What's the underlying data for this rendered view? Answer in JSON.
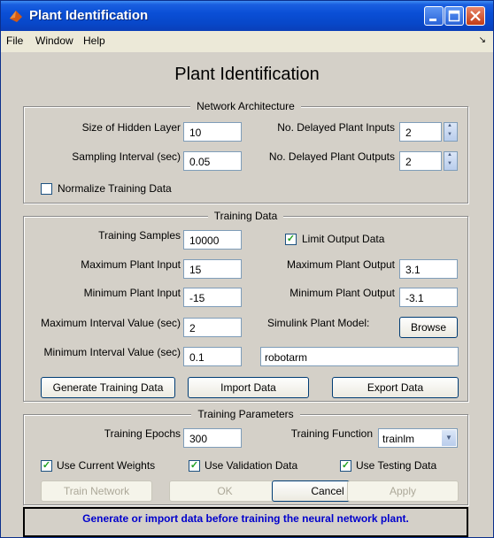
{
  "window": {
    "title": "Plant Identification"
  },
  "menu": {
    "items": [
      "File",
      "Window",
      "Help"
    ]
  },
  "heading": "Plant Identification",
  "network_architecture": {
    "title": "Network Architecture",
    "hidden_layer_label": "Size of Hidden Layer",
    "hidden_layer_value": "10",
    "sampling_interval_label": "Sampling Interval (sec)",
    "sampling_interval_value": "0.05",
    "delayed_inputs_label": "No. Delayed Plant Inputs",
    "delayed_inputs_value": "2",
    "delayed_outputs_label": "No. Delayed Plant Outputs",
    "delayed_outputs_value": "2",
    "normalize_label": "Normalize Training Data",
    "normalize_checked": false
  },
  "training_data": {
    "title": "Training Data",
    "samples_label": "Training Samples",
    "samples_value": "10000",
    "limit_output_label": "Limit Output Data",
    "limit_output_checked": true,
    "max_input_label": "Maximum Plant Input",
    "max_input_value": "15",
    "max_output_label": "Maximum Plant Output",
    "max_output_value": "3.1",
    "min_input_label": "Minimum Plant Input",
    "min_input_value": "-15",
    "min_output_label": "Minimum Plant Output",
    "min_output_value": "-3.1",
    "max_interval_label": "Maximum Interval Value (sec)",
    "max_interval_value": "2",
    "min_interval_label": "Minimum Interval Value (sec)",
    "min_interval_value": "0.1",
    "simulink_label": "Simulink Plant Model:",
    "browse_label": "Browse",
    "model_value": "robotarm",
    "generate_label": "Generate Training Data",
    "import_label": "Import Data",
    "export_label": "Export Data"
  },
  "training_parameters": {
    "title": "Training Parameters",
    "epochs_label": "Training Epochs",
    "epochs_value": "300",
    "function_label": "Training Function",
    "function_value": "trainlm",
    "current_weights_label": "Use Current Weights",
    "validation_label": "Use Validation Data",
    "testing_label": "Use Testing Data"
  },
  "buttons": {
    "train_label": "Train Network",
    "ok_label": "OK",
    "cancel_label": "Cancel",
    "apply_label": "Apply"
  },
  "status_message": "Generate or import data before training the neural network plant."
}
